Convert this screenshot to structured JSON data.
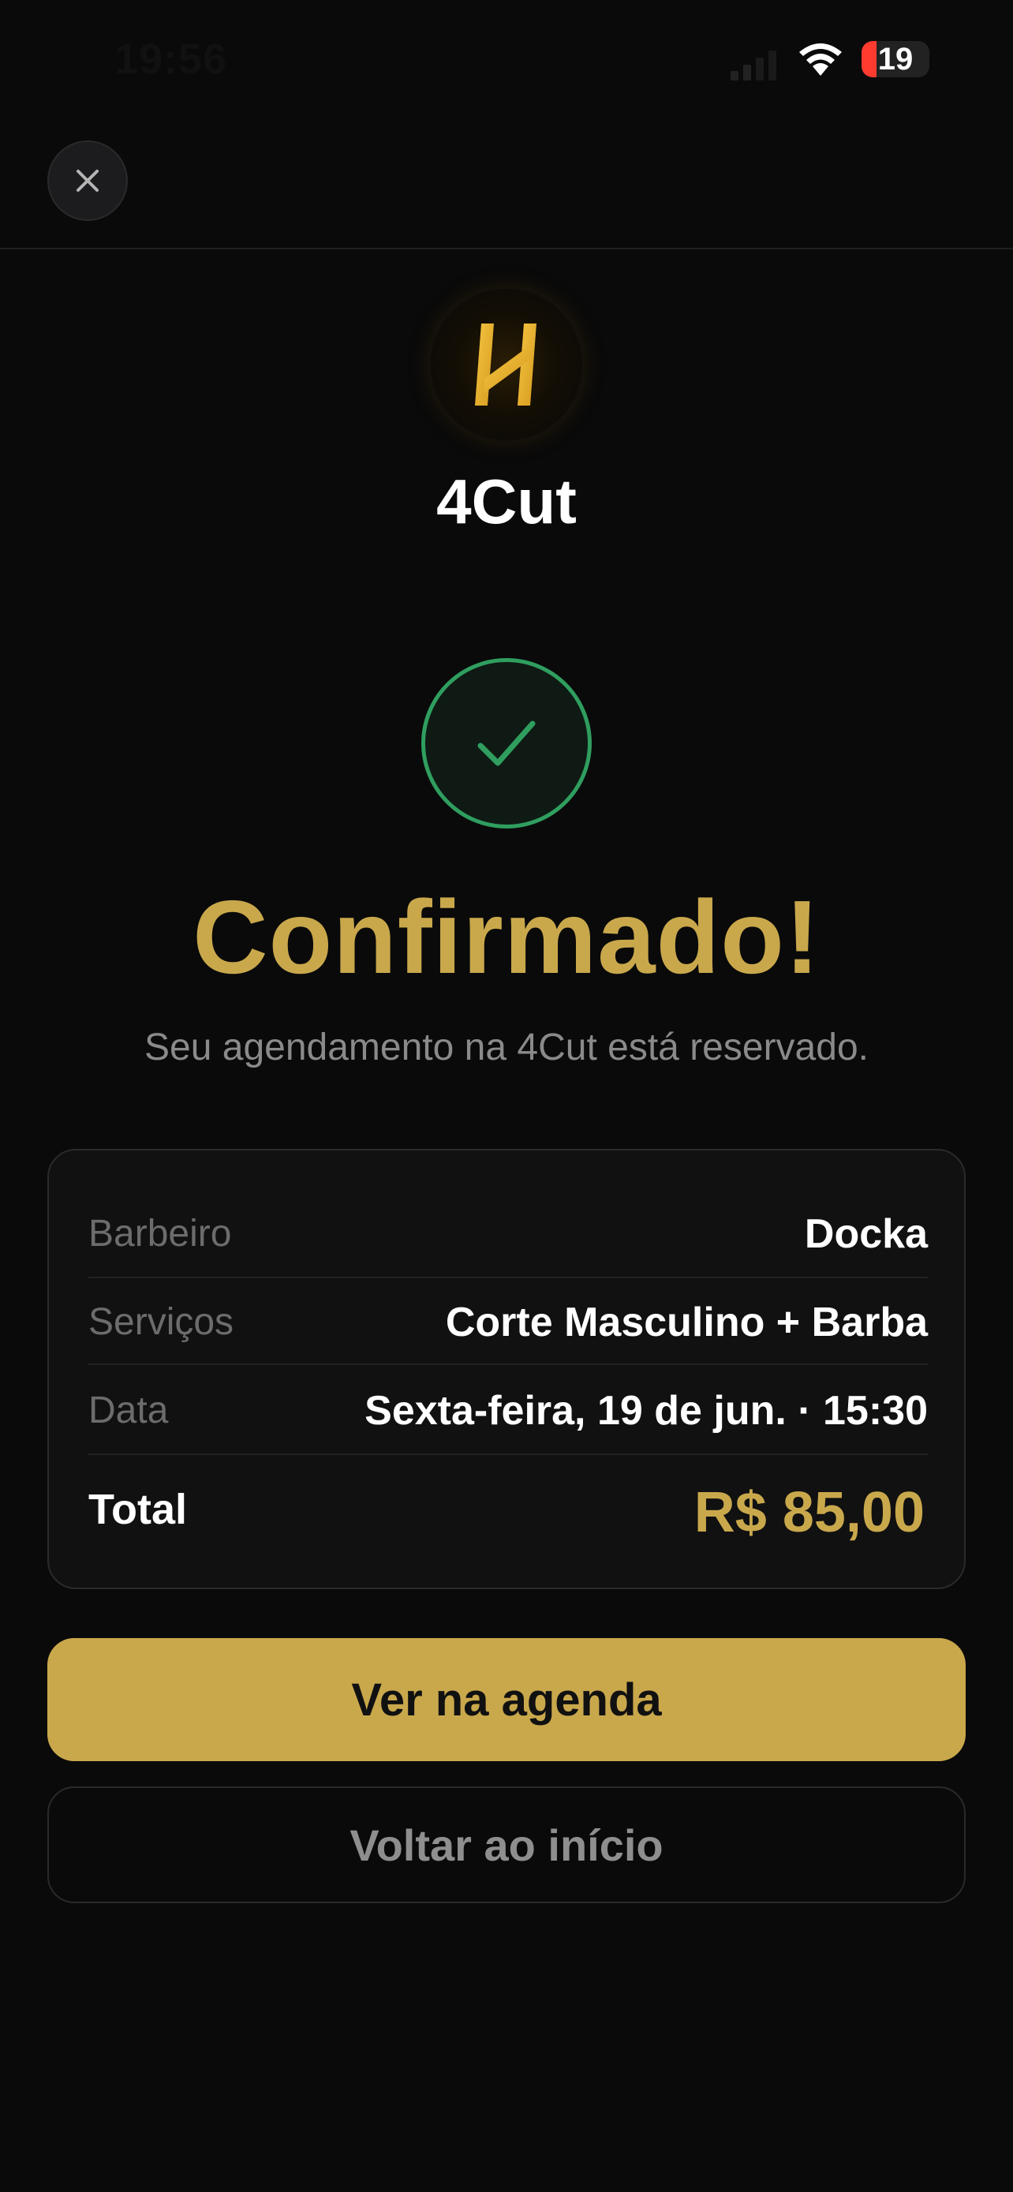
{
  "status_bar": {
    "time": "19:56",
    "battery_level": "19",
    "battery_color": "#ff3b30"
  },
  "header": {
    "close_icon": "close-icon"
  },
  "brand": {
    "logo_icon": "4cut-logo-icon",
    "name": "4Cut",
    "accent_color": "#c9a84c"
  },
  "confirmation": {
    "status_icon": "check-icon",
    "status_color": "#2f9e5f",
    "title": "Confirmado!",
    "subtitle": "Seu agendamento na 4Cut está reservado."
  },
  "summary": {
    "rows": [
      {
        "label": "Barbeiro",
        "value": "Docka"
      },
      {
        "label": "Serviços",
        "value": "Corte Masculino + Barba"
      },
      {
        "label": "Data",
        "value": "Sexta-feira, 19 de jun. · 15:30"
      }
    ],
    "total_label": "Total",
    "total_value": "R$ 85,00"
  },
  "actions": {
    "primary_label": "Ver na agenda",
    "secondary_label": "Voltar ao início"
  }
}
